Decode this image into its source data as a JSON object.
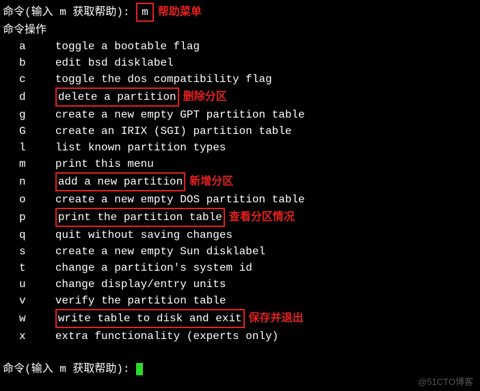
{
  "prompt": {
    "label": "命令(输入 m 获取帮助): ",
    "typed": "m",
    "annotation": "帮助菜单"
  },
  "section_title": "命令操作",
  "menu": [
    {
      "key": "a",
      "desc": "toggle a bootable flag",
      "boxed": false,
      "annotation": ""
    },
    {
      "key": "b",
      "desc": "edit bsd disklabel",
      "boxed": false,
      "annotation": ""
    },
    {
      "key": "c",
      "desc": "toggle the dos compatibility flag",
      "boxed": false,
      "annotation": ""
    },
    {
      "key": "d",
      "desc": "delete a partition",
      "boxed": true,
      "annotation": "删除分区"
    },
    {
      "key": "g",
      "desc": "create a new empty GPT partition table",
      "boxed": false,
      "annotation": ""
    },
    {
      "key": "G",
      "desc": "create an IRIX (SGI) partition table",
      "boxed": false,
      "annotation": ""
    },
    {
      "key": "l",
      "desc": "list known partition types",
      "boxed": false,
      "annotation": ""
    },
    {
      "key": "m",
      "desc": "print this menu",
      "boxed": false,
      "annotation": ""
    },
    {
      "key": "n",
      "desc": "add a new partition",
      "boxed": true,
      "annotation": "新增分区"
    },
    {
      "key": "o",
      "desc": "create a new empty DOS partition table",
      "boxed": false,
      "annotation": ""
    },
    {
      "key": "p",
      "desc": "print the partition table",
      "boxed": true,
      "annotation": "查看分区情况"
    },
    {
      "key": "q",
      "desc": "quit without saving changes",
      "boxed": false,
      "annotation": ""
    },
    {
      "key": "s",
      "desc": "create a new empty Sun disklabel",
      "boxed": false,
      "annotation": ""
    },
    {
      "key": "t",
      "desc": "change a partition's system id",
      "boxed": false,
      "annotation": ""
    },
    {
      "key": "u",
      "desc": "change display/entry units",
      "boxed": false,
      "annotation": ""
    },
    {
      "key": "v",
      "desc": "verify the partition table",
      "boxed": false,
      "annotation": ""
    },
    {
      "key": "w",
      "desc": "write table to disk and exit",
      "boxed": true,
      "annotation": "保存并退出"
    },
    {
      "key": "x",
      "desc": "extra functionality (experts only)",
      "boxed": false,
      "annotation": ""
    }
  ],
  "prompt2": {
    "label": "命令(输入 m 获取帮助): "
  },
  "watermark": "@51CTO博客"
}
